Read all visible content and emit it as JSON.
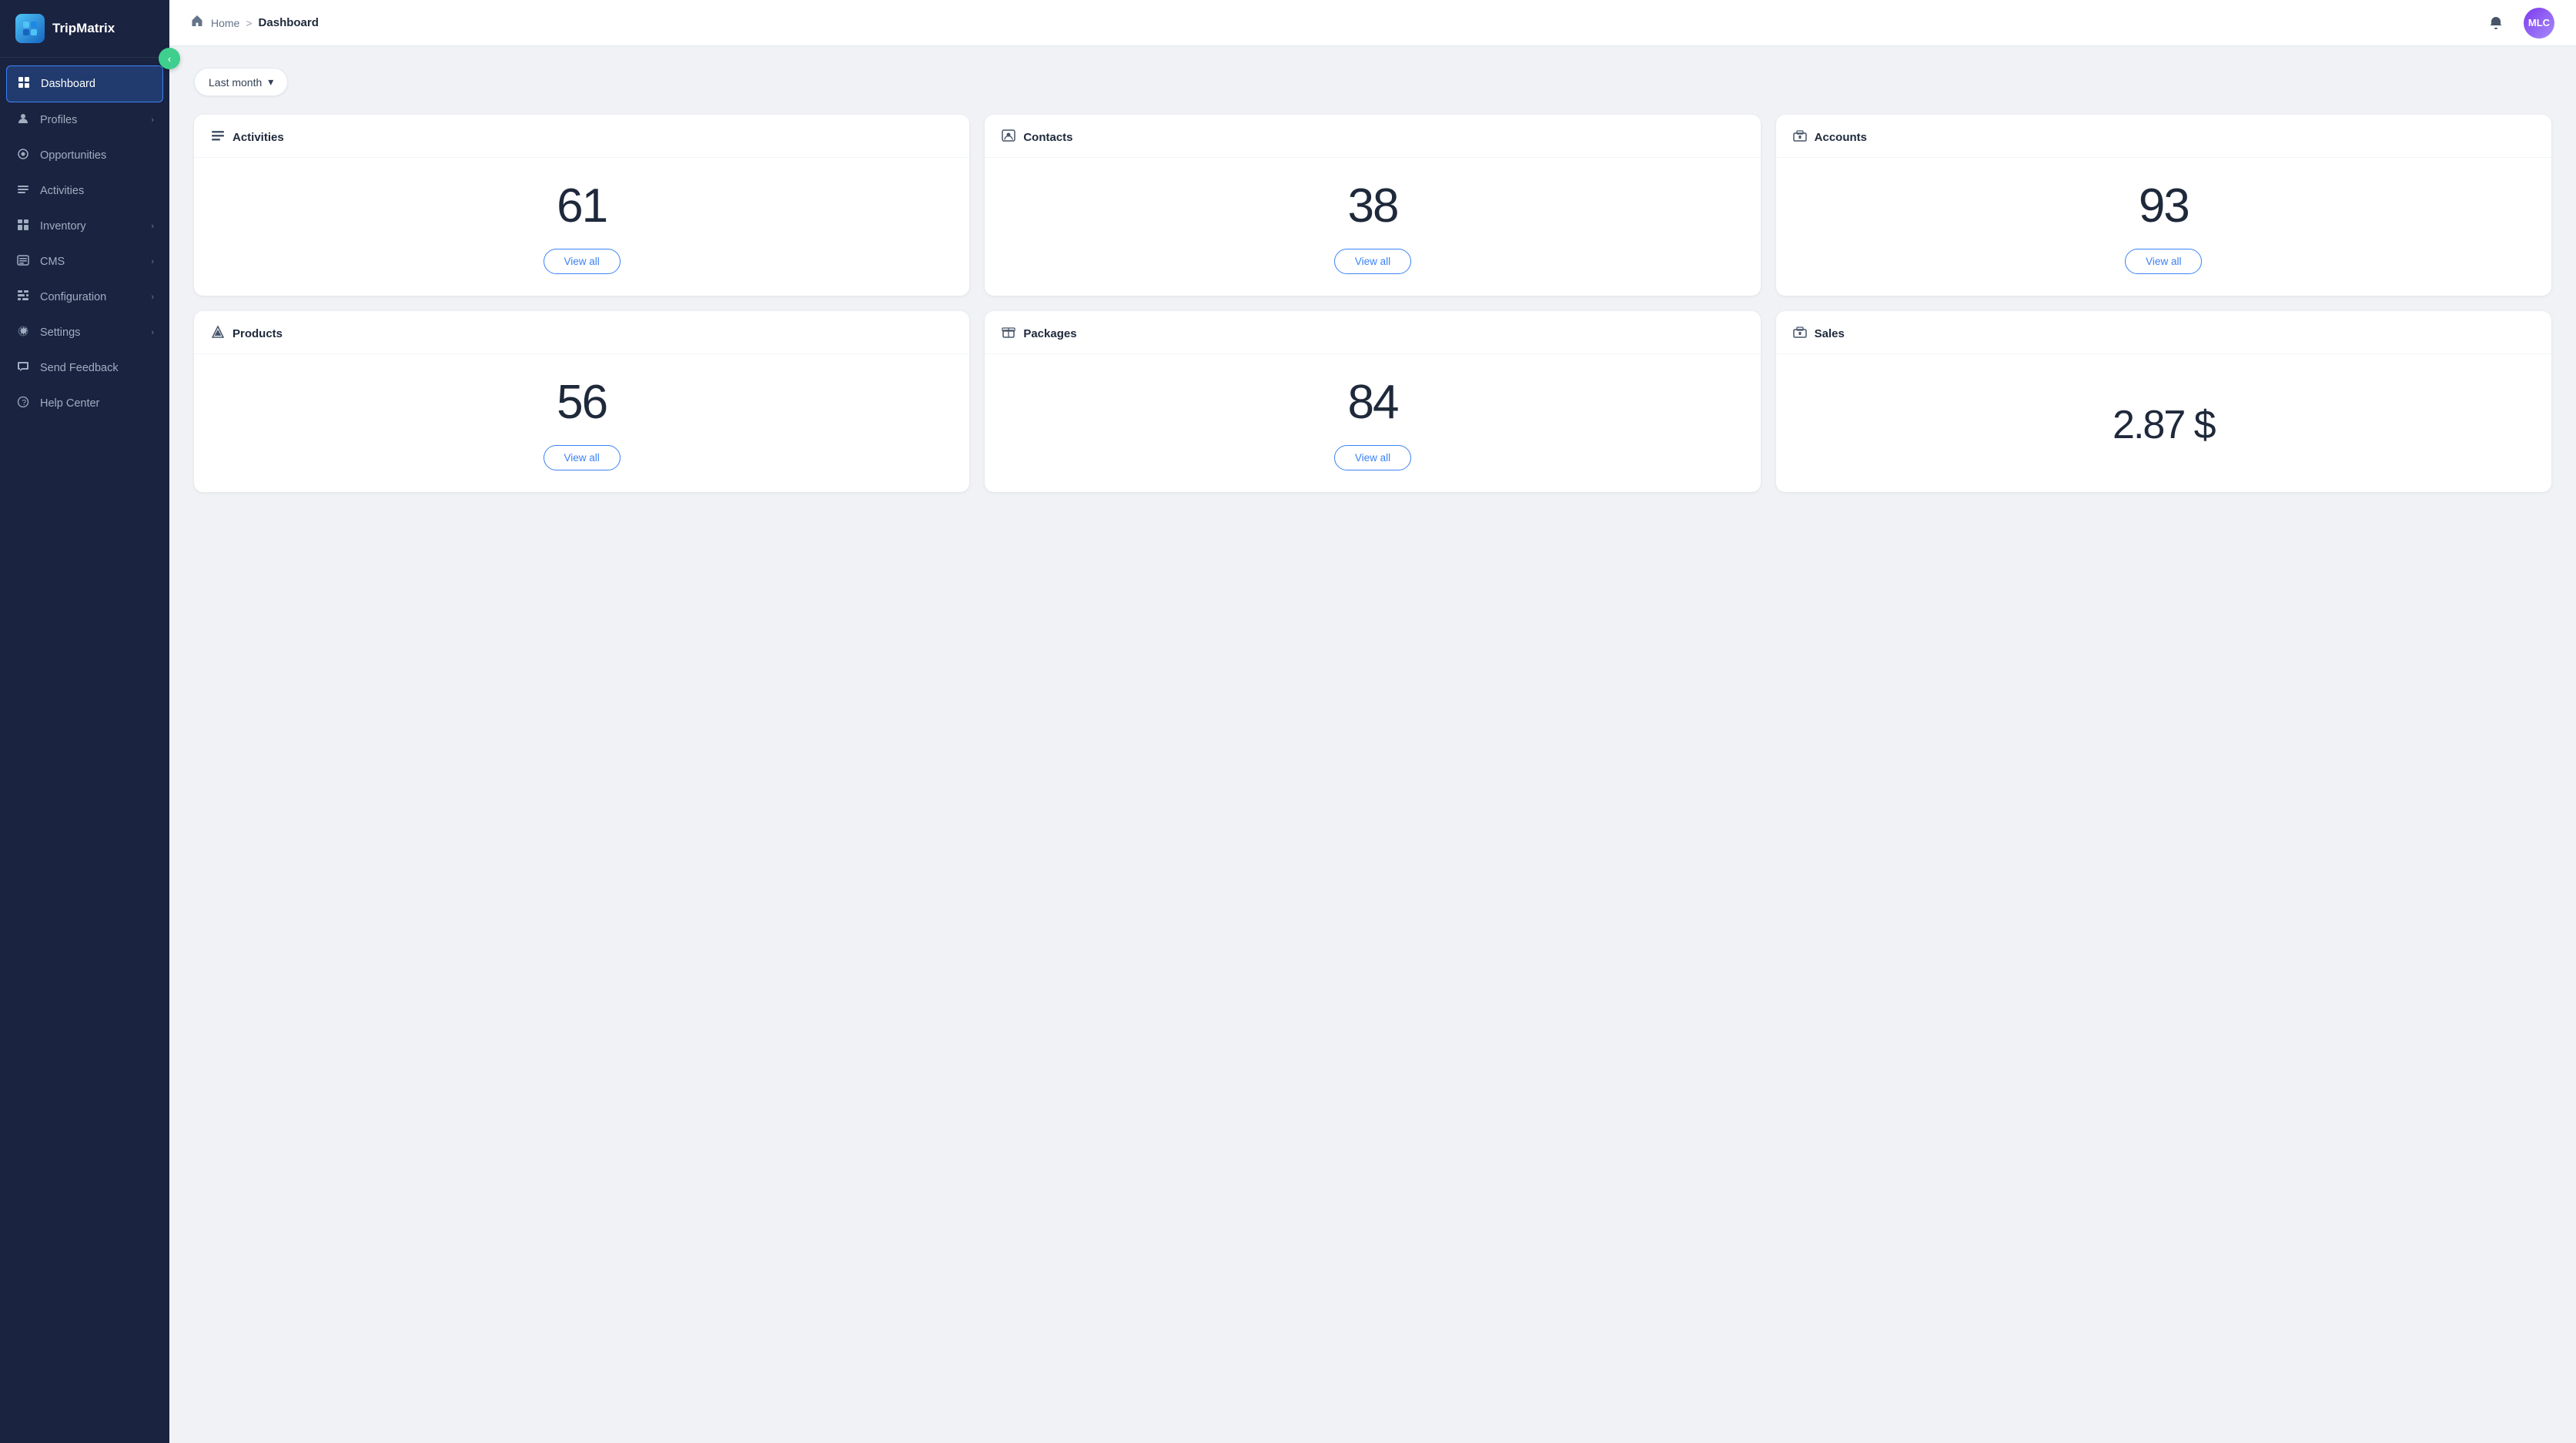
{
  "app": {
    "name": "TripMatrix",
    "logo_emoji": "🧊"
  },
  "topbar": {
    "home_label": "Home",
    "separator": ">",
    "current_label": "Dashboard",
    "avatar_initials": "MLC"
  },
  "filter": {
    "label": "Last month",
    "chevron": "▾"
  },
  "sidebar": {
    "toggle_icon": "‹",
    "items": [
      {
        "id": "dashboard",
        "label": "Dashboard",
        "icon": "▦",
        "active": true,
        "has_children": false
      },
      {
        "id": "profiles",
        "label": "Profiles",
        "icon": "👤",
        "active": false,
        "has_children": true
      },
      {
        "id": "opportunities",
        "label": "Opportunities",
        "icon": "🌐",
        "active": false,
        "has_children": false
      },
      {
        "id": "activities",
        "label": "Activities",
        "icon": "≡",
        "active": false,
        "has_children": false
      },
      {
        "id": "inventory",
        "label": "Inventory",
        "icon": "🗂",
        "active": false,
        "has_children": true
      },
      {
        "id": "cms",
        "label": "CMS",
        "icon": "📋",
        "active": false,
        "has_children": true
      },
      {
        "id": "configuration",
        "label": "Configuration",
        "icon": "⊞",
        "active": false,
        "has_children": true
      },
      {
        "id": "settings",
        "label": "Settings",
        "icon": "⚙",
        "active": false,
        "has_children": true
      },
      {
        "id": "send-feedback",
        "label": "Send Feedback",
        "icon": "💬",
        "active": false,
        "has_children": false
      },
      {
        "id": "help-center",
        "label": "Help Center",
        "icon": "❓",
        "active": false,
        "has_children": false
      }
    ]
  },
  "stats": [
    {
      "id": "activities",
      "icon": "≡",
      "title": "Activities",
      "value": "61",
      "unit": "",
      "view_all_label": "View all"
    },
    {
      "id": "contacts",
      "icon": "👤",
      "title": "Contacts",
      "value": "38",
      "unit": "",
      "view_all_label": "View all"
    },
    {
      "id": "accounts",
      "icon": "🏛",
      "title": "Accounts",
      "value": "93",
      "unit": "",
      "view_all_label": "View all"
    },
    {
      "id": "products",
      "icon": "▲",
      "title": "Products",
      "value": "56",
      "unit": "",
      "view_all_label": "View all"
    },
    {
      "id": "packages",
      "icon": "📦",
      "title": "Packages",
      "value": "84",
      "unit": "",
      "view_all_label": "View all"
    },
    {
      "id": "sales",
      "icon": "🏛",
      "title": "Sales",
      "value": "2.87 $",
      "unit": "$",
      "view_all_label": ""
    }
  ]
}
